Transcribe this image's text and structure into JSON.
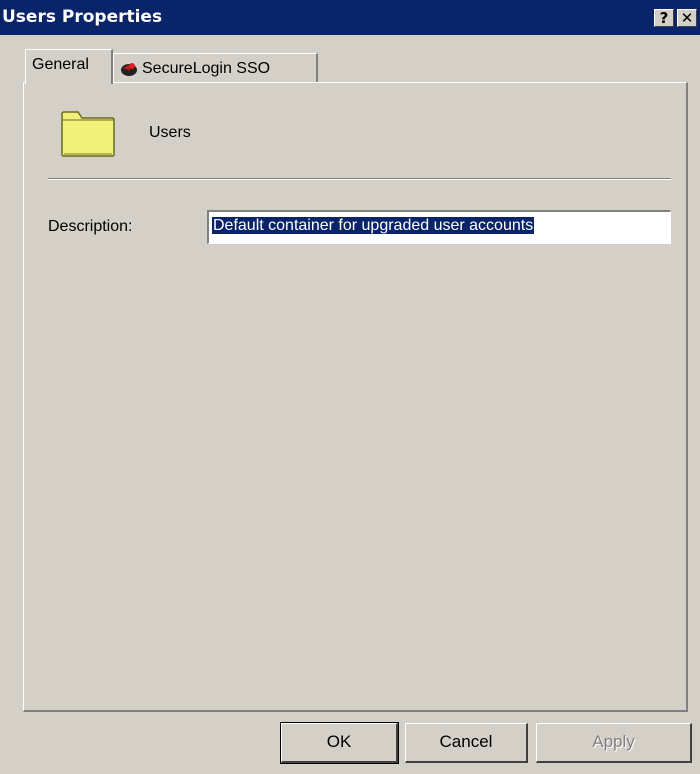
{
  "window": {
    "title": "Users Properties",
    "help_glyph": "?",
    "close_glyph": "✕"
  },
  "tabs": [
    {
      "label": "General",
      "selected": true
    },
    {
      "label": "SecureLogin SSO",
      "icon": "securelogin-icon",
      "selected": false
    }
  ],
  "general": {
    "object_icon": "folder-icon",
    "object_name": "Users",
    "description_label": "Description:",
    "description_value": "Default container for upgraded user accounts"
  },
  "buttons": {
    "ok": "OK",
    "cancel": "Cancel",
    "apply": "Apply"
  },
  "colors": {
    "titlebar": "#0a246a",
    "face": "#d4d0c8",
    "selection": "#0a246a",
    "folder": "#f0f07a"
  }
}
